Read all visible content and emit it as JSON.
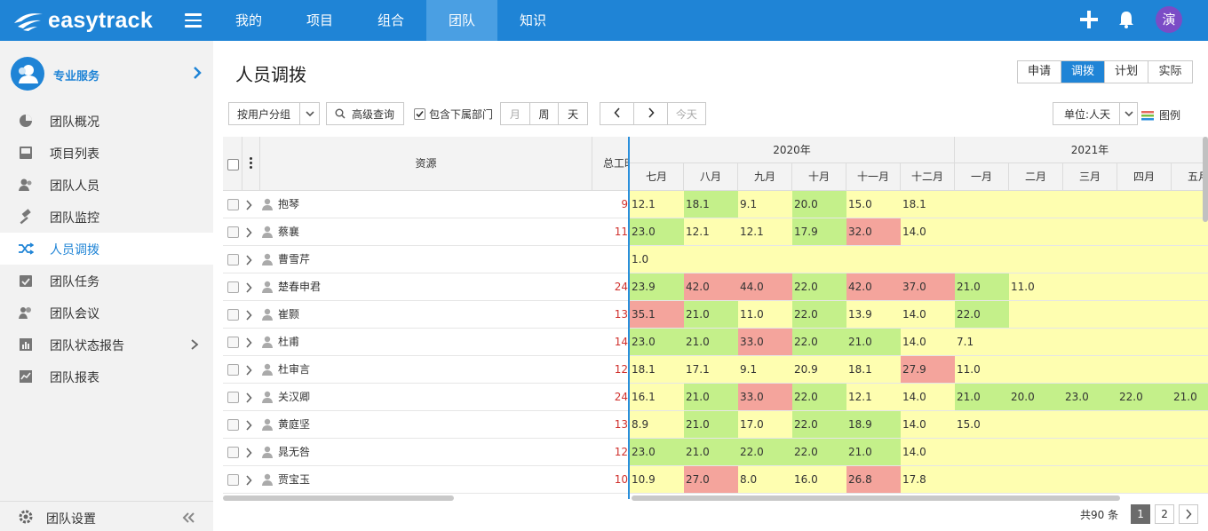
{
  "app": {
    "logo_text": "easytrack",
    "avatar_text": "演"
  },
  "nav": [
    "我的",
    "项目",
    "组合",
    "团队",
    "知识"
  ],
  "nav_active": 3,
  "sidebar": {
    "title": "专业服务",
    "items": [
      {
        "label": "团队概况",
        "icon": "pie-chart-icon"
      },
      {
        "label": "项目列表",
        "icon": "inbox-icon"
      },
      {
        "label": "团队人员",
        "icon": "users-icon"
      },
      {
        "label": "团队监控",
        "icon": "gavel-icon"
      },
      {
        "label": "人员调拨",
        "icon": "shuffle-icon"
      },
      {
        "label": "团队任务",
        "icon": "calendar-check-icon"
      },
      {
        "label": "团队会议",
        "icon": "meeting-icon"
      },
      {
        "label": "团队状态报告",
        "icon": "bar-report-icon"
      },
      {
        "label": "团队报表",
        "icon": "line-report-icon"
      }
    ],
    "active_index": 4,
    "settings_label": "团队设置"
  },
  "page": {
    "title": "人员调拨",
    "mode_tabs": [
      "申请",
      "调拨",
      "计划",
      "实际"
    ],
    "mode_active": 1,
    "group_select": "按用户分组",
    "advanced_search": "高级查询",
    "include_sub_label": "包含下属部门",
    "granularity": [
      "月",
      "周",
      "天"
    ],
    "today": "今天",
    "unit_select": "单位:人天",
    "legend_label": "图例"
  },
  "grid": {
    "col_resource": "资源",
    "col_total": "总工时",
    "year_groups": [
      "2020年",
      "2021年"
    ],
    "months": [
      "七月",
      "八月",
      "九月",
      "十月",
      "十一月",
      "十二月",
      "一月",
      "二月",
      "三月",
      "四月",
      "五月"
    ],
    "rows": [
      {
        "name": "抱琴",
        "total": "9",
        "cells": [
          "12.1",
          "18.1",
          "9.1",
          "20.0",
          "15.0",
          "18.1",
          "",
          "",
          "",
          "",
          ""
        ],
        "colors": [
          "y",
          "g",
          "y",
          "g",
          "y",
          "y",
          "y",
          "y",
          "y",
          "y",
          "y"
        ]
      },
      {
        "name": "蔡襄",
        "total": "11",
        "cells": [
          "23.0",
          "12.1",
          "12.1",
          "17.9",
          "32.0",
          "14.0",
          "",
          "",
          "",
          "",
          ""
        ],
        "colors": [
          "g",
          "y",
          "y",
          "g",
          "r",
          "y",
          "y",
          "y",
          "y",
          "y",
          "y"
        ]
      },
      {
        "name": "曹雪芹",
        "total": "",
        "cells": [
          "1.0",
          "",
          "",
          "",
          "",
          "",
          "",
          "",
          "",
          "",
          ""
        ],
        "colors": [
          "y",
          "y",
          "y",
          "y",
          "y",
          "y",
          "y",
          "y",
          "y",
          "y",
          "y"
        ]
      },
      {
        "name": "楚春申君",
        "total": "24",
        "cells": [
          "23.9",
          "42.0",
          "44.0",
          "22.0",
          "42.0",
          "37.0",
          "21.0",
          "11.0",
          "",
          "",
          ""
        ],
        "colors": [
          "g",
          "r",
          "r",
          "g",
          "r",
          "r",
          "g",
          "y",
          "y",
          "y",
          "y"
        ]
      },
      {
        "name": "崔颢",
        "total": "13",
        "cells": [
          "35.1",
          "21.0",
          "11.0",
          "22.0",
          "13.9",
          "14.0",
          "22.0",
          "",
          "",
          "",
          ""
        ],
        "colors": [
          "r",
          "g",
          "y",
          "g",
          "y",
          "y",
          "g",
          "y",
          "y",
          "y",
          "y"
        ]
      },
      {
        "name": "杜甫",
        "total": "14",
        "cells": [
          "23.0",
          "21.0",
          "33.0",
          "22.0",
          "21.0",
          "14.0",
          "7.1",
          "",
          "",
          "",
          ""
        ],
        "colors": [
          "g",
          "g",
          "r",
          "g",
          "g",
          "y",
          "y",
          "y",
          "y",
          "y",
          "y"
        ]
      },
      {
        "name": "杜审言",
        "total": "12",
        "cells": [
          "18.1",
          "17.1",
          "9.1",
          "20.9",
          "18.1",
          "27.9",
          "11.0",
          "",
          "",
          "",
          ""
        ],
        "colors": [
          "y",
          "y",
          "y",
          "y",
          "y",
          "r",
          "y",
          "y",
          "y",
          "y",
          "y"
        ]
      },
      {
        "name": "关汉卿",
        "total": "24",
        "cells": [
          "16.1",
          "21.0",
          "33.0",
          "22.0",
          "12.1",
          "14.0",
          "21.0",
          "20.0",
          "23.0",
          "22.0",
          "21.0"
        ],
        "colors": [
          "y",
          "g",
          "r",
          "g",
          "y",
          "y",
          "g",
          "g",
          "g",
          "g",
          "g"
        ]
      },
      {
        "name": "黄庭坚",
        "total": "13",
        "cells": [
          "8.9",
          "21.0",
          "17.0",
          "22.0",
          "18.9",
          "14.0",
          "15.0",
          "",
          "",
          "",
          ""
        ],
        "colors": [
          "y",
          "g",
          "y",
          "g",
          "g",
          "y",
          "y",
          "y",
          "y",
          "y",
          "y"
        ]
      },
      {
        "name": "晁无咎",
        "total": "12",
        "cells": [
          "23.0",
          "21.0",
          "22.0",
          "22.0",
          "21.0",
          "14.0",
          "",
          "",
          "",
          "",
          ""
        ],
        "colors": [
          "g",
          "g",
          "g",
          "g",
          "g",
          "y",
          "y",
          "y",
          "y",
          "y",
          "y"
        ]
      },
      {
        "name": "贾宝玉",
        "total": "10",
        "cells": [
          "10.9",
          "27.0",
          "8.0",
          "16.0",
          "26.8",
          "17.8",
          "",
          "",
          "",
          "",
          ""
        ],
        "colors": [
          "y",
          "r",
          "y",
          "y",
          "r",
          "y",
          "y",
          "y",
          "y",
          "y",
          "y"
        ]
      }
    ]
  },
  "colors": {
    "y": "#fefeb0",
    "g": "#c4f08a",
    "r": "#f4a49c",
    "accent": "#1f84d6"
  },
  "pagination": {
    "total": "共90 条",
    "pages": [
      "1",
      "2"
    ],
    "current": "1"
  }
}
